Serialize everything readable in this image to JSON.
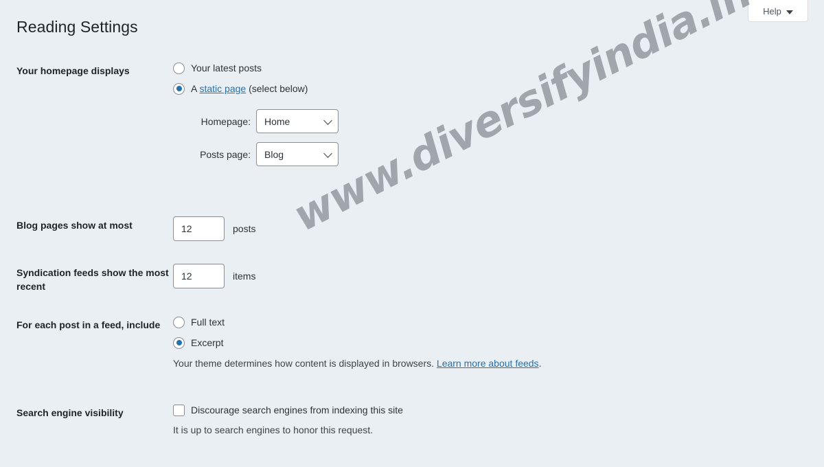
{
  "header": {
    "help_button": {
      "label": "Help",
      "caret_icon": "chevron-down-icon"
    },
    "title": "Reading Settings"
  },
  "watermark": {
    "text": "www.diversifyindia.in",
    "color": "#9aa0a6"
  },
  "theme": {
    "background": "#eaeff3",
    "accent": "#2271b1",
    "text": "#1d2327",
    "border": "#8c8f94"
  },
  "sections": {
    "homepage_displays": {
      "label": "Your homepage displays",
      "options": [
        {
          "label": "Your latest posts",
          "selected": false
        },
        {
          "label_prefix": "A ",
          "link_text": "static page",
          "label_suffix": " (select below)",
          "selected": true
        }
      ],
      "selects": [
        {
          "caption": "Homepage:",
          "value": "Home"
        },
        {
          "caption": "Posts page:",
          "value": "Blog"
        }
      ]
    },
    "blog_pages": {
      "label": "Blog pages show at most",
      "value": "12",
      "unit": "posts"
    },
    "syndication_feeds": {
      "label": "Syndication feeds show the most recent",
      "value": "12",
      "unit": "items"
    },
    "feed_include": {
      "label": "For each post in a feed, include",
      "options": [
        {
          "label": "Full text",
          "selected": false
        },
        {
          "label": "Excerpt",
          "selected": true
        }
      ],
      "hint_prefix": "Your theme determines how content is displayed in browsers. ",
      "hint_link": "Learn more about feeds",
      "hint_suffix": "."
    },
    "search_engine_visibility": {
      "label": "Search engine visibility",
      "checkbox_label": "Discourage search engines from indexing this site",
      "checked": false,
      "hint": "It is up to search engines to honor this request."
    }
  }
}
